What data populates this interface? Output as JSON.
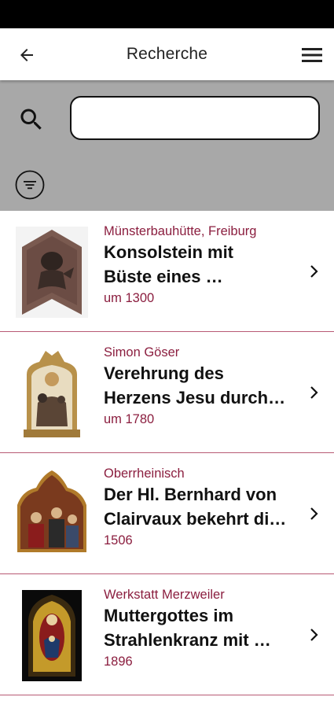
{
  "appbar": {
    "title": "Recherche"
  },
  "search": {
    "value": "",
    "placeholder": ""
  },
  "items": [
    {
      "artist": "Münsterbauhütte, Freiburg",
      "title_line1": "Konsolstein mit",
      "title_line2": "Büste eines …",
      "date": "um 1300"
    },
    {
      "artist": "Simon Göser",
      "title_line1": "Verehrung des",
      "title_line2": "Herzens Jesu durch…",
      "date": "um 1780"
    },
    {
      "artist": "Oberrheinisch",
      "title_line1": "Der Hl. Bernhard von",
      "title_line2": "Clairvaux bekehrt di…",
      "date": "1506"
    },
    {
      "artist": "Werkstatt Merzweiler",
      "title_line1": "Muttergottes im",
      "title_line2": "Strahlenkranz mit …",
      "date": "1896"
    }
  ],
  "colors": {
    "accent": "#8b1e3f",
    "divider": "#b85a74",
    "search_panel": "#a8a8a8"
  },
  "icons": {
    "back": "arrow-back-icon",
    "menu": "hamburger-menu-icon",
    "search": "search-icon",
    "filter": "filter-icon",
    "item": "chevron-right-icon"
  }
}
